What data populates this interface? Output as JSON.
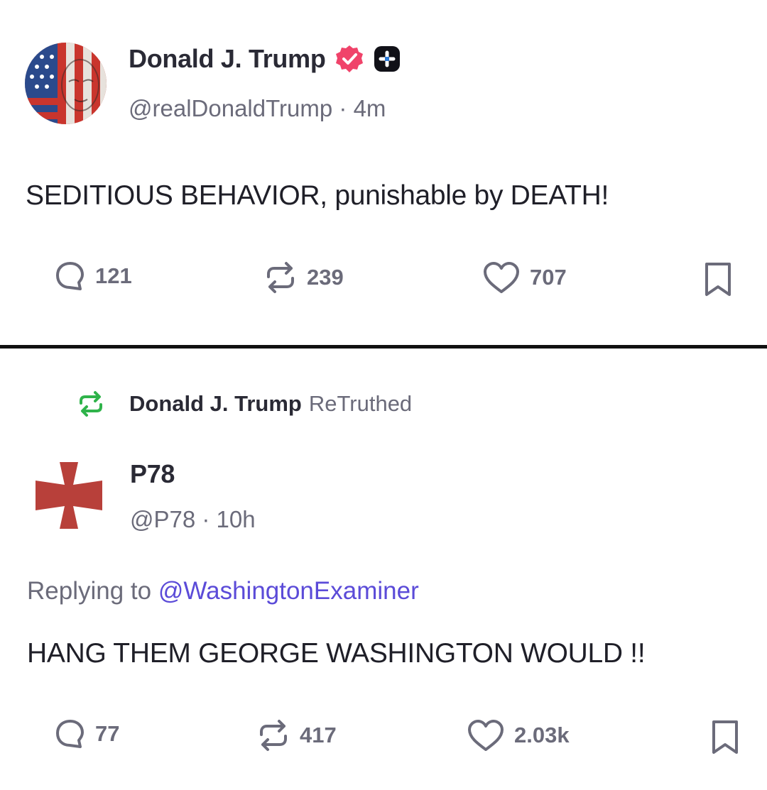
{
  "post1": {
    "display_name": "Donald J. Trump",
    "handle": "@realDonaldTrump",
    "time": "4m",
    "body": "SEDITIOUS BEHAVIOR, punishable by DEATH!",
    "replies": "121",
    "retruths": "239",
    "likes": "707"
  },
  "post2": {
    "retruth_by": "Donald J. Trump",
    "retruth_label": "ReTruthed",
    "display_name": "P78",
    "handle": "@P78",
    "time": "10h",
    "replying_prefix": "Replying to",
    "replying_to": "@WashingtonExaminer",
    "body": "HANG THEM GEORGE WASHINGTON WOULD !!",
    "replies": "77",
    "retruths": "417",
    "likes": "2.03k"
  },
  "colors": {
    "verified_badge": "#f0436a",
    "retruth_green": "#2fb34a",
    "mention_link": "#5b4bd8",
    "muted_text": "#6b6b7a",
    "cross_red": "#b8403a"
  },
  "icons": [
    "reply-icon",
    "retruth-icon",
    "like-icon",
    "bookmark-icon",
    "verified-badge-icon",
    "plus-badge-icon"
  ]
}
